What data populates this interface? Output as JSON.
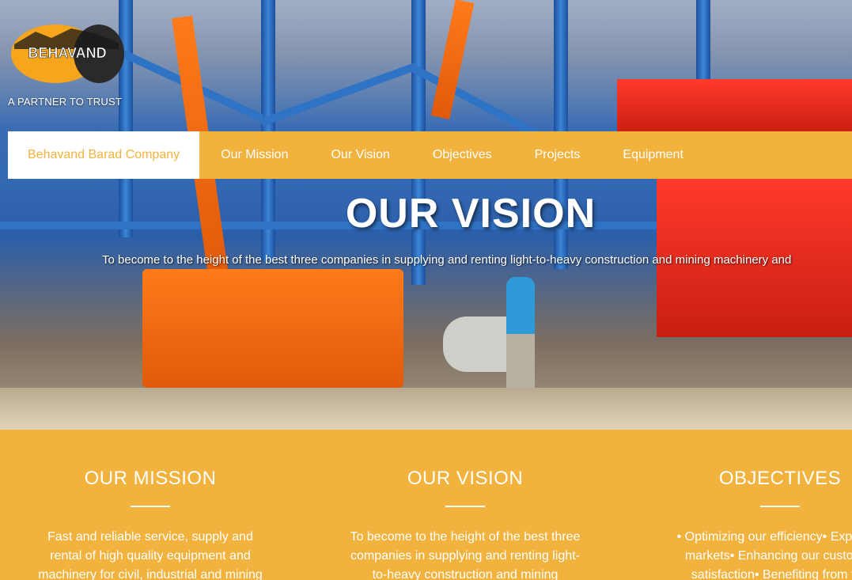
{
  "brand": {
    "logo_text": "BEHAVAND",
    "tagline": "A PARTNER TO TRUST"
  },
  "nav": {
    "items": [
      {
        "label": "Behavand Barad Company",
        "active": true
      },
      {
        "label": "Our Mission"
      },
      {
        "label": "Our Vision"
      },
      {
        "label": "Objectives"
      },
      {
        "label": "Projects"
      },
      {
        "label": "Equipment"
      }
    ]
  },
  "hero": {
    "title": "OUR VISION",
    "text": "To become to the height of the best three companies in supplying and renting light-to-heavy construction and mining machinery and"
  },
  "features": [
    {
      "title": "OUR MISSION",
      "text": "Fast and reliable service, supply and rental of high quality equipment and machinery for civil, industrial and mining projects."
    },
    {
      "title": "OUR VISION",
      "text": "To become to the height of the best three companies in supplying and renting light-to-heavy construction and mining"
    },
    {
      "title": "OBJECTIVES",
      "text": "• Optimizing our efficiency• Exploring markets• Enhancing our customer satisfaction• Benefiting from the"
    }
  ],
  "colors": {
    "accent": "#f2b23e",
    "white": "#ffffff"
  }
}
